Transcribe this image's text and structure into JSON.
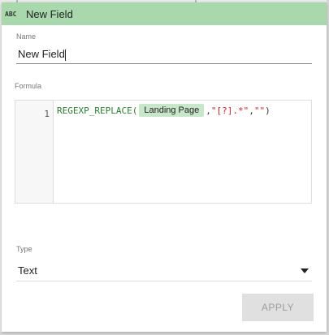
{
  "dialog": {
    "header_icon": "abc-text-type-icon",
    "header_icon_text": "ABC",
    "title": "New Field",
    "header_color": "#a8d8ab"
  },
  "name_field": {
    "label": "Name",
    "value": "New Field"
  },
  "formula_field": {
    "label": "Formula",
    "line_number": "1",
    "function_name": "REGEXP_REPLACE(",
    "field_chip": "Landing Page",
    "comma1": ",",
    "arg_pattern": "\"[?].*\"",
    "comma2": ",",
    "arg_replacement": "\"\"",
    "close_paren": ")"
  },
  "type_field": {
    "label": "Type",
    "value": "Text",
    "dropdown_icon": "caret-down-icon"
  },
  "apply_button": {
    "label": "APPLY",
    "enabled": false
  }
}
